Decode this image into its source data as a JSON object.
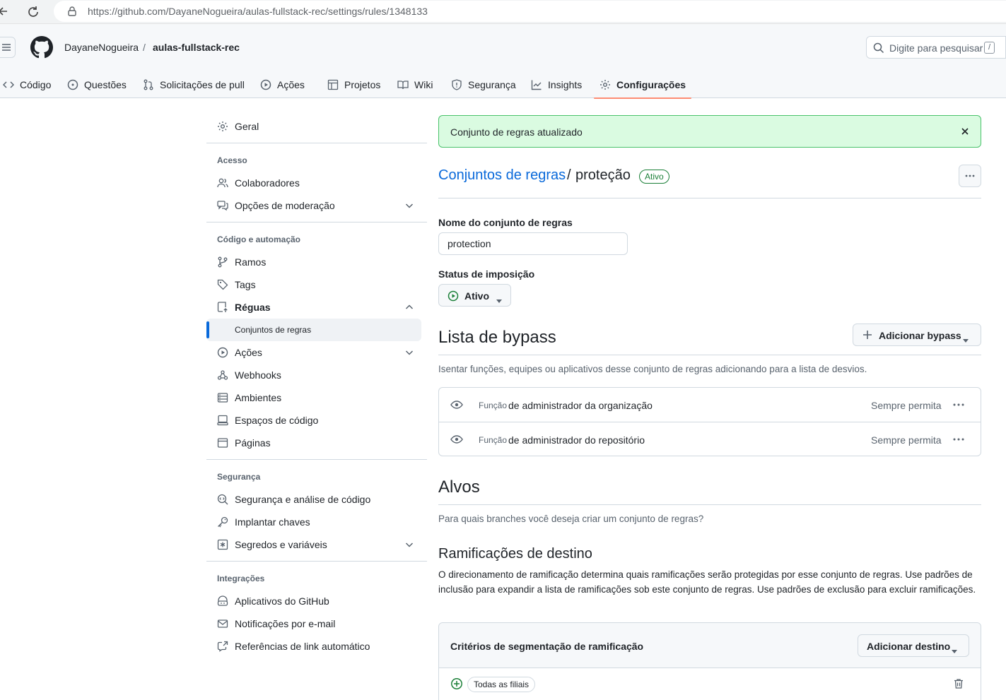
{
  "browser": {
    "url": "https://github.com/DayaneNogueira/aulas-fullstack-rec/settings/rules/1348133"
  },
  "header": {
    "owner": "DayaneNogueira",
    "separator": "/",
    "repo": "aulas-fullstack-rec",
    "search_placeholder": "Digite para pesquisar",
    "search_key": "/"
  },
  "tabs": [
    {
      "label": "Código",
      "icon": "code-icon"
    },
    {
      "label": "Questões",
      "icon": "issue-icon"
    },
    {
      "label": "Solicitações de pull",
      "icon": "pull-request-icon"
    },
    {
      "label": "Ações",
      "icon": "play-icon"
    },
    {
      "label": "Projetos",
      "icon": "table-icon"
    },
    {
      "label": "Wiki",
      "icon": "book-icon"
    },
    {
      "label": "Segurança",
      "icon": "shield-icon"
    },
    {
      "label": "Insights",
      "icon": "graph-icon"
    },
    {
      "label": "Configurações",
      "icon": "gear-icon",
      "active": true
    }
  ],
  "sidebar": {
    "general": "Geral",
    "groups": {
      "access": "Acesso",
      "code_automation": "Código e automação",
      "security": "Segurança",
      "integrations": "Integrações"
    },
    "items": {
      "collaborators": "Colaboradores",
      "moderation": "Opções de moderação",
      "branches": "Ramos",
      "tags": "Tags",
      "rules": "Réguas",
      "rulesets": "Conjuntos de regras",
      "actions": "Ações",
      "webhooks": "Webhooks",
      "environments": "Ambientes",
      "codespaces": "Espaços de código",
      "pages": "Páginas",
      "code_security": "Segurança e análise de código",
      "deploy_keys": "Implantar chaves",
      "secrets": "Segredos e variáveis",
      "github_apps": "Aplicativos do GitHub",
      "email_notifications": "Notificações por e-mail",
      "autolink": "Referências de link automático"
    }
  },
  "main": {
    "flash": "Conjunto de regras atualizado",
    "breadcrumb_link": "Conjuntos de regras",
    "breadcrumb_sep": "/",
    "ruleset_title": "proteção",
    "status_badge": "Ativo",
    "name_label": "Nome do conjunto de regras",
    "name_value": "protection",
    "enforcement_label": "Status de imposição",
    "enforcement_value": "Ativo",
    "bypass": {
      "title": "Lista de bypass",
      "add_button": "Adicionar bypass",
      "description": "Isentar funções, equipes ou aplicativos desse conjunto de regras adicionando para a lista de desvios.",
      "rows": [
        {
          "kind": "Função",
          "name": "de administrador da organização",
          "mode": "Sempre permita"
        },
        {
          "kind": "Função",
          "name": "de administrador do repositório",
          "mode": "Sempre permita"
        }
      ]
    },
    "targets": {
      "title": "Alvos",
      "description": "Para quais branches você deseja criar um conjunto de regras?",
      "branch_title": "Ramificações de destino",
      "branch_description": "O direcionamento de ramificação determina quais ramificações serão protegidas por esse conjunto de regras. Use padrões de inclusão para expandir a lista de ramificações sob este conjunto de regras. Use padrões de exclusão para excluir ramificações.",
      "criteria_title": "Critérios de segmentação de ramificação",
      "add_target": "Adicionar destino",
      "chip": "Todas as filiais"
    }
  },
  "colors": {
    "accent": "#0969da",
    "success": "#1a7f37",
    "flash_bg": "#dafbe1",
    "tab_underline": "#fd8c73"
  }
}
